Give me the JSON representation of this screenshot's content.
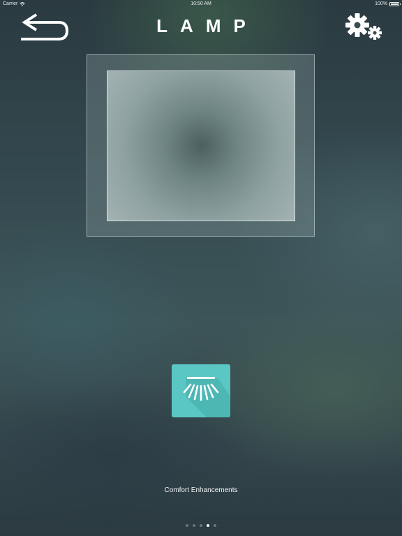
{
  "status_bar": {
    "carrier": "Carrier",
    "time": "10:50 AM",
    "battery": "100%",
    "battery_level": 1.0
  },
  "header": {
    "title": "LAMP",
    "back_icon": "back-arrow-icon",
    "settings_icon": "gear-icon"
  },
  "feature": {
    "label": "Comfort Enhancements",
    "icon": "lamp-light-icon",
    "tile_color": "#5bc7c4"
  },
  "pagination": {
    "total": 5,
    "active_index": 3
  }
}
